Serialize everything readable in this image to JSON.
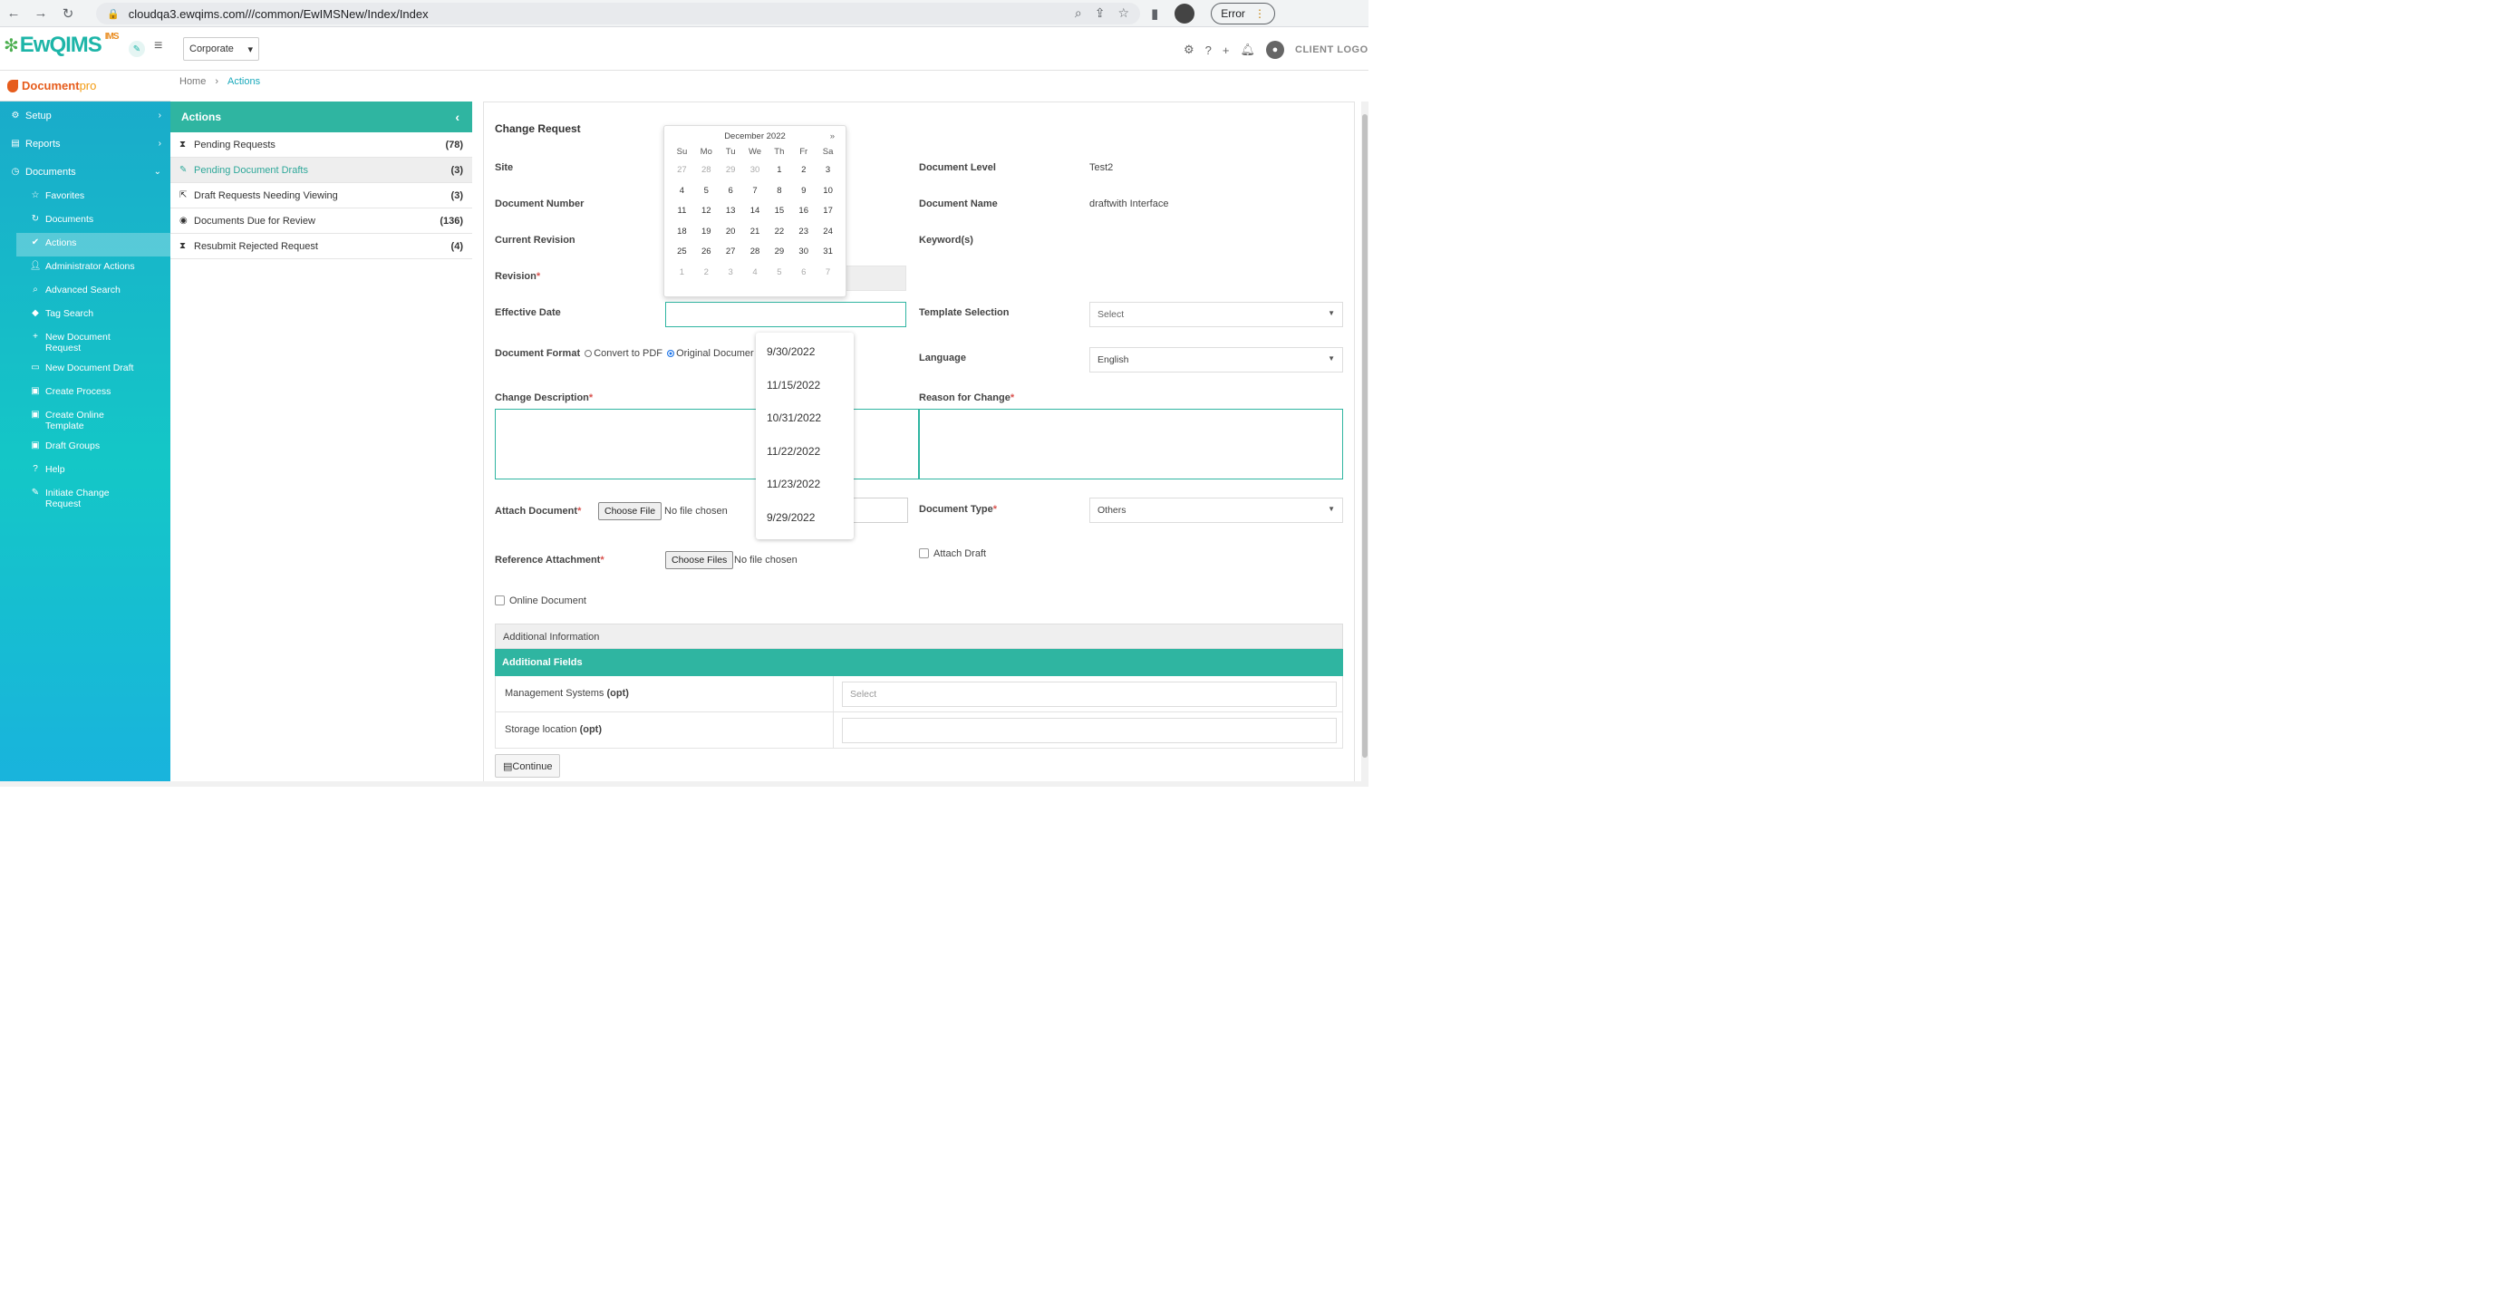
{
  "browser": {
    "url": "cloudqa3.ewqims.com///common/EwIMSNew/Index/Index",
    "error_label": "Error"
  },
  "header": {
    "logo_text": "EwQIMS",
    "logo_sup": "IMS",
    "site_select": "Corporate",
    "client_logo": "CLIENT LOGO"
  },
  "sidebar": {
    "brand": "Document",
    "brand_suffix": "pro",
    "items": [
      {
        "label": "Setup",
        "icon": "gears-icon"
      },
      {
        "label": "Reports",
        "icon": "report-icon"
      },
      {
        "label": "Documents",
        "icon": "documents-icon"
      }
    ],
    "subitems": [
      {
        "label": "Favorites",
        "icon": "star-icon"
      },
      {
        "label": "Documents",
        "icon": "refresh-icon"
      },
      {
        "label": "Actions",
        "icon": "check-icon"
      },
      {
        "label": "Administrator Actions",
        "icon": "user-icon"
      },
      {
        "label": "Advanced Search",
        "icon": "search-icon"
      },
      {
        "label": "Tag Search",
        "icon": "tag-icon"
      },
      {
        "label": "New Document Request",
        "icon": "plus-icon"
      },
      {
        "label": "New Document Draft",
        "icon": "doc-icon"
      },
      {
        "label": "Create Process",
        "icon": "process-icon"
      },
      {
        "label": "Create Online Template",
        "icon": "template-icon"
      },
      {
        "label": "Draft Groups",
        "icon": "group-icon"
      },
      {
        "label": "Help",
        "icon": "help-icon"
      },
      {
        "label": "Initiate Change Request",
        "icon": "change-icon"
      }
    ]
  },
  "breadcrumb": {
    "home": "Home",
    "sep": "›",
    "current": "Actions"
  },
  "actions": {
    "title": "Actions",
    "rows": [
      {
        "label": "Pending Requests",
        "count": "(78)"
      },
      {
        "label": "Pending Document Drafts",
        "count": "(3)"
      },
      {
        "label": "Draft Requests Needing Viewing",
        "count": "(3)"
      },
      {
        "label": "Documents Due for Review",
        "count": "(136)"
      },
      {
        "label": "Resubmit Rejected Request",
        "count": "(4)"
      }
    ]
  },
  "form": {
    "title": "Change Request",
    "site_label": "Site",
    "doc_number_label": "Document Number",
    "current_revision_label": "Current Revision",
    "revision_label": "Revision",
    "effective_date_label": "Effective Date",
    "doc_format_label": "Document Format",
    "convert_pdf": "Convert to PDF",
    "original_doc": "Original Documer",
    "change_desc_label": "Change Description",
    "doc_level_label": "Document Level",
    "doc_level_value": "Test2",
    "doc_name_label": "Document Name",
    "doc_name_value": "draftwith Interface",
    "keywords_label": "Keyword(s)",
    "template_sel_label": "Template Selection",
    "template_sel_value": "Select",
    "language_label": "Language",
    "language_value": "English",
    "reason_label": "Reason for Change",
    "attach_doc_label": "Attach Document",
    "choose_file": "Choose File",
    "no_file": "No file chosen",
    "doc_type_label": "Document Type",
    "doc_type_value": "Others",
    "ref_attach_label": "Reference Attachment",
    "choose_files": "Choose Files",
    "attach_draft": "Attach Draft",
    "online_doc": "Online Document",
    "addl_info": "Additional Information",
    "addl_fields": "Additional Fields",
    "field1_label": "Management Systems",
    "field1_opt": "(opt)",
    "field1_value": "Select",
    "field2_label": "Storage location",
    "field2_opt": "(opt)",
    "continue": "Continue",
    "required_mark": "*"
  },
  "calendar": {
    "month": "December 2022",
    "next": "»",
    "dow": [
      "Su",
      "Mo",
      "Tu",
      "We",
      "Th",
      "Fr",
      "Sa"
    ],
    "weeks": [
      [
        "27",
        "28",
        "29",
        "30",
        "1",
        "2",
        "3"
      ],
      [
        "4",
        "5",
        "6",
        "7",
        "8",
        "9",
        "10"
      ],
      [
        "11",
        "12",
        "13",
        "14",
        "15",
        "16",
        "17"
      ],
      [
        "18",
        "19",
        "20",
        "21",
        "22",
        "23",
        "24"
      ],
      [
        "25",
        "26",
        "27",
        "28",
        "29",
        "30",
        "31"
      ],
      [
        "1",
        "2",
        "3",
        "4",
        "5",
        "6",
        "7"
      ]
    ]
  },
  "autocomplete": [
    "9/30/2022",
    "11/15/2022",
    "10/31/2022",
    "11/22/2022",
    "11/23/2022",
    "9/29/2022"
  ]
}
